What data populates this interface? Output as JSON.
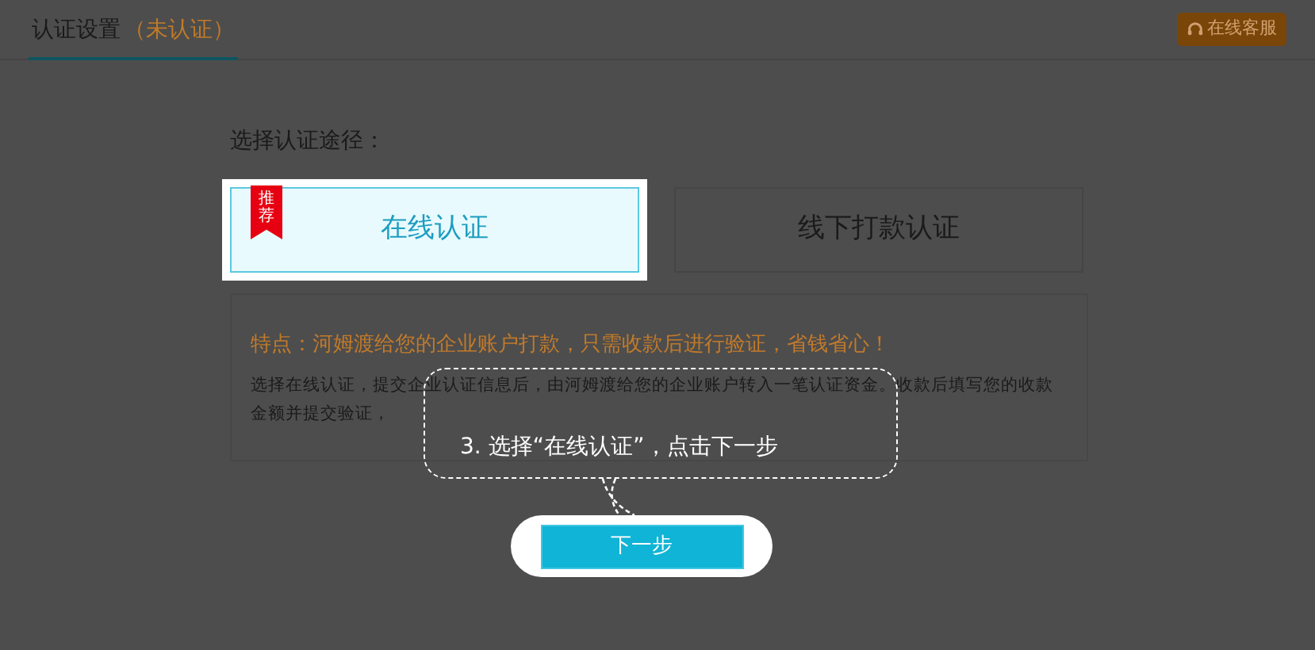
{
  "header": {
    "title": "认证设置",
    "status": "（未认证）",
    "service_button": "在线客服"
  },
  "prompt": "选择认证途径：",
  "options": [
    {
      "label": "在线认证",
      "selected": true,
      "badge": "推荐"
    },
    {
      "label": "线下打款认证",
      "selected": false
    }
  ],
  "info": {
    "headline": "特点：河姆渡给您的企业账户打款，只需收款后进行验证，省钱省心！",
    "body": "选择在线认证，提交企业认证信息后，由河姆渡给您的企业账户转入一笔认证资金。收款后填写您的收款金额并提交验证，"
  },
  "tooltip": "3. 选择“在线认证”，点击下一步",
  "next_button": "下一步"
}
